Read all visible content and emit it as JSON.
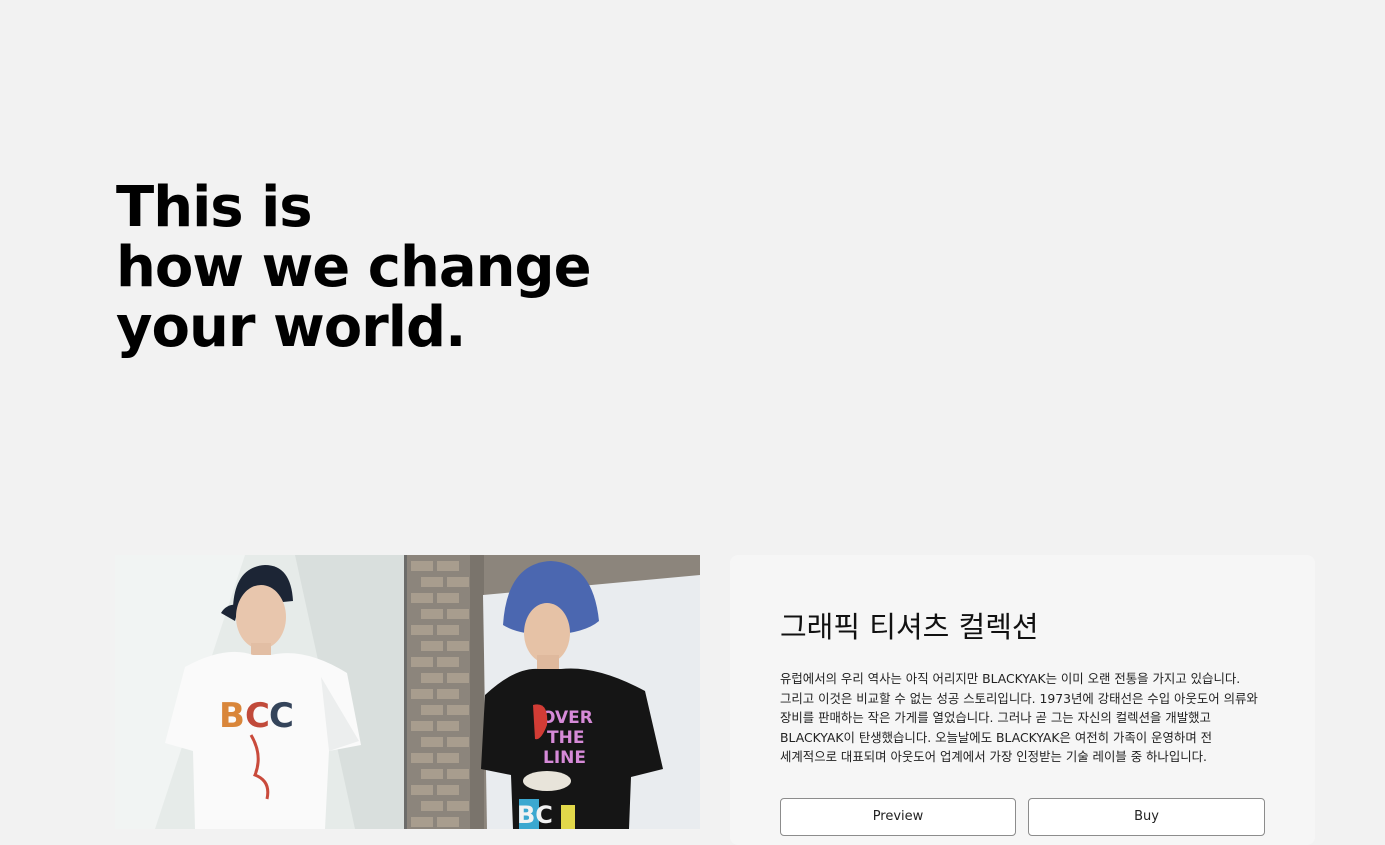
{
  "hero": {
    "line1": "This is",
    "line2": "how we change",
    "line3": "your world."
  },
  "product": {
    "image_alt": "그래픽 티셔츠 컬렉션",
    "title": "그래픽 티셔츠 컬렉션",
    "description": "유럽에서의 우리 역사는 아직 어리지만 BLACKYAK는 이미 오랜 전통을 가지고 있습니다. 그리고 이것은 비교할 수 없는 성공 스토리입니다. 1973년에 강태선은 수입 아웃도어 의류와 장비를 판매하는 작은 가게를 열었습니다. 그러나 곧 그는 자신의 컬렉션을 개발했고 BLACKYAK이 탄생했습니다. 오늘날에도 BLACKYAK은 여전히 가족이 운영하며 전 세계적으로 대표되며 아웃도어 업계에서 가장 인정받는 기술 레이블 중 하나입니다.",
    "preview_label": "Preview",
    "buy_label": "Buy"
  },
  "colors": {
    "page_bg": "#f2f2f2",
    "card_bg": "#f6f6f6",
    "text": "#000000",
    "button_border": "#8c8c8c"
  }
}
